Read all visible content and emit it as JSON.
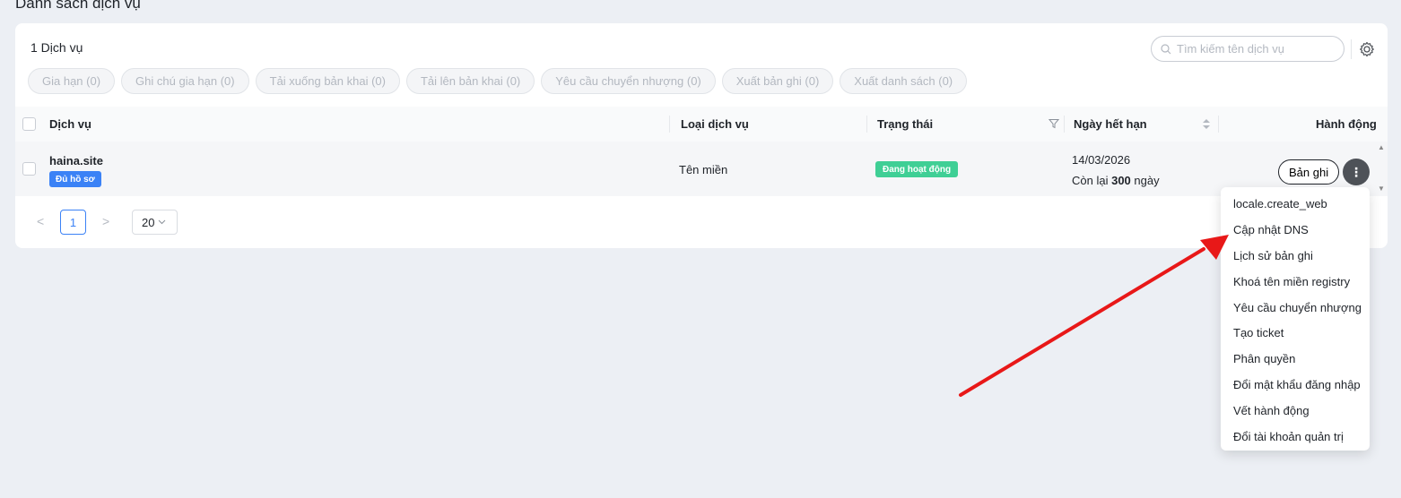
{
  "page": {
    "title": "Danh sách dịch vụ"
  },
  "toolbar": {
    "count": "1 Dịch vụ",
    "search_placeholder": "Tìm kiếm tên dịch vụ",
    "actions": [
      "Gia hạn (0)",
      "Ghi chú gia hạn (0)",
      "Tải xuống bản khai (0)",
      "Tải lên bản khai (0)",
      "Yêu cầu chuyển nhượng (0)",
      "Xuất bản ghi (0)",
      "Xuất danh sách (0)"
    ]
  },
  "table": {
    "headers": {
      "service": "Dịch vụ",
      "type": "Loại dịch vụ",
      "status": "Trạng thái",
      "expiry": "Ngày hết hạn",
      "action": "Hành động"
    },
    "rows": [
      {
        "name": "haina.site",
        "profile_badge": "Đủ hồ sơ",
        "type": "Tên miền",
        "status": "Đang hoạt động",
        "expiry_date": "14/03/2026",
        "remaining_prefix": "Còn lại",
        "remaining_days": "300",
        "remaining_suffix": "ngày",
        "record_button": "Bản ghi"
      }
    ]
  },
  "pagination": {
    "current": "1",
    "page_size": "20"
  },
  "menu": {
    "items": [
      "locale.create_web",
      "Cập nhật DNS",
      "Lịch sử bản ghi",
      "Khoá tên miền registry",
      "Yêu cầu chuyển nhượng",
      "Tạo ticket",
      "Phân quyền",
      "Đổi mật khẩu đăng nhập",
      "Vết hành động",
      "Đổi tài khoản quản trị"
    ]
  },
  "colors": {
    "accent": "#3b82f6",
    "status_active": "#3fcf95",
    "annotation_arrow": "#e81818"
  }
}
